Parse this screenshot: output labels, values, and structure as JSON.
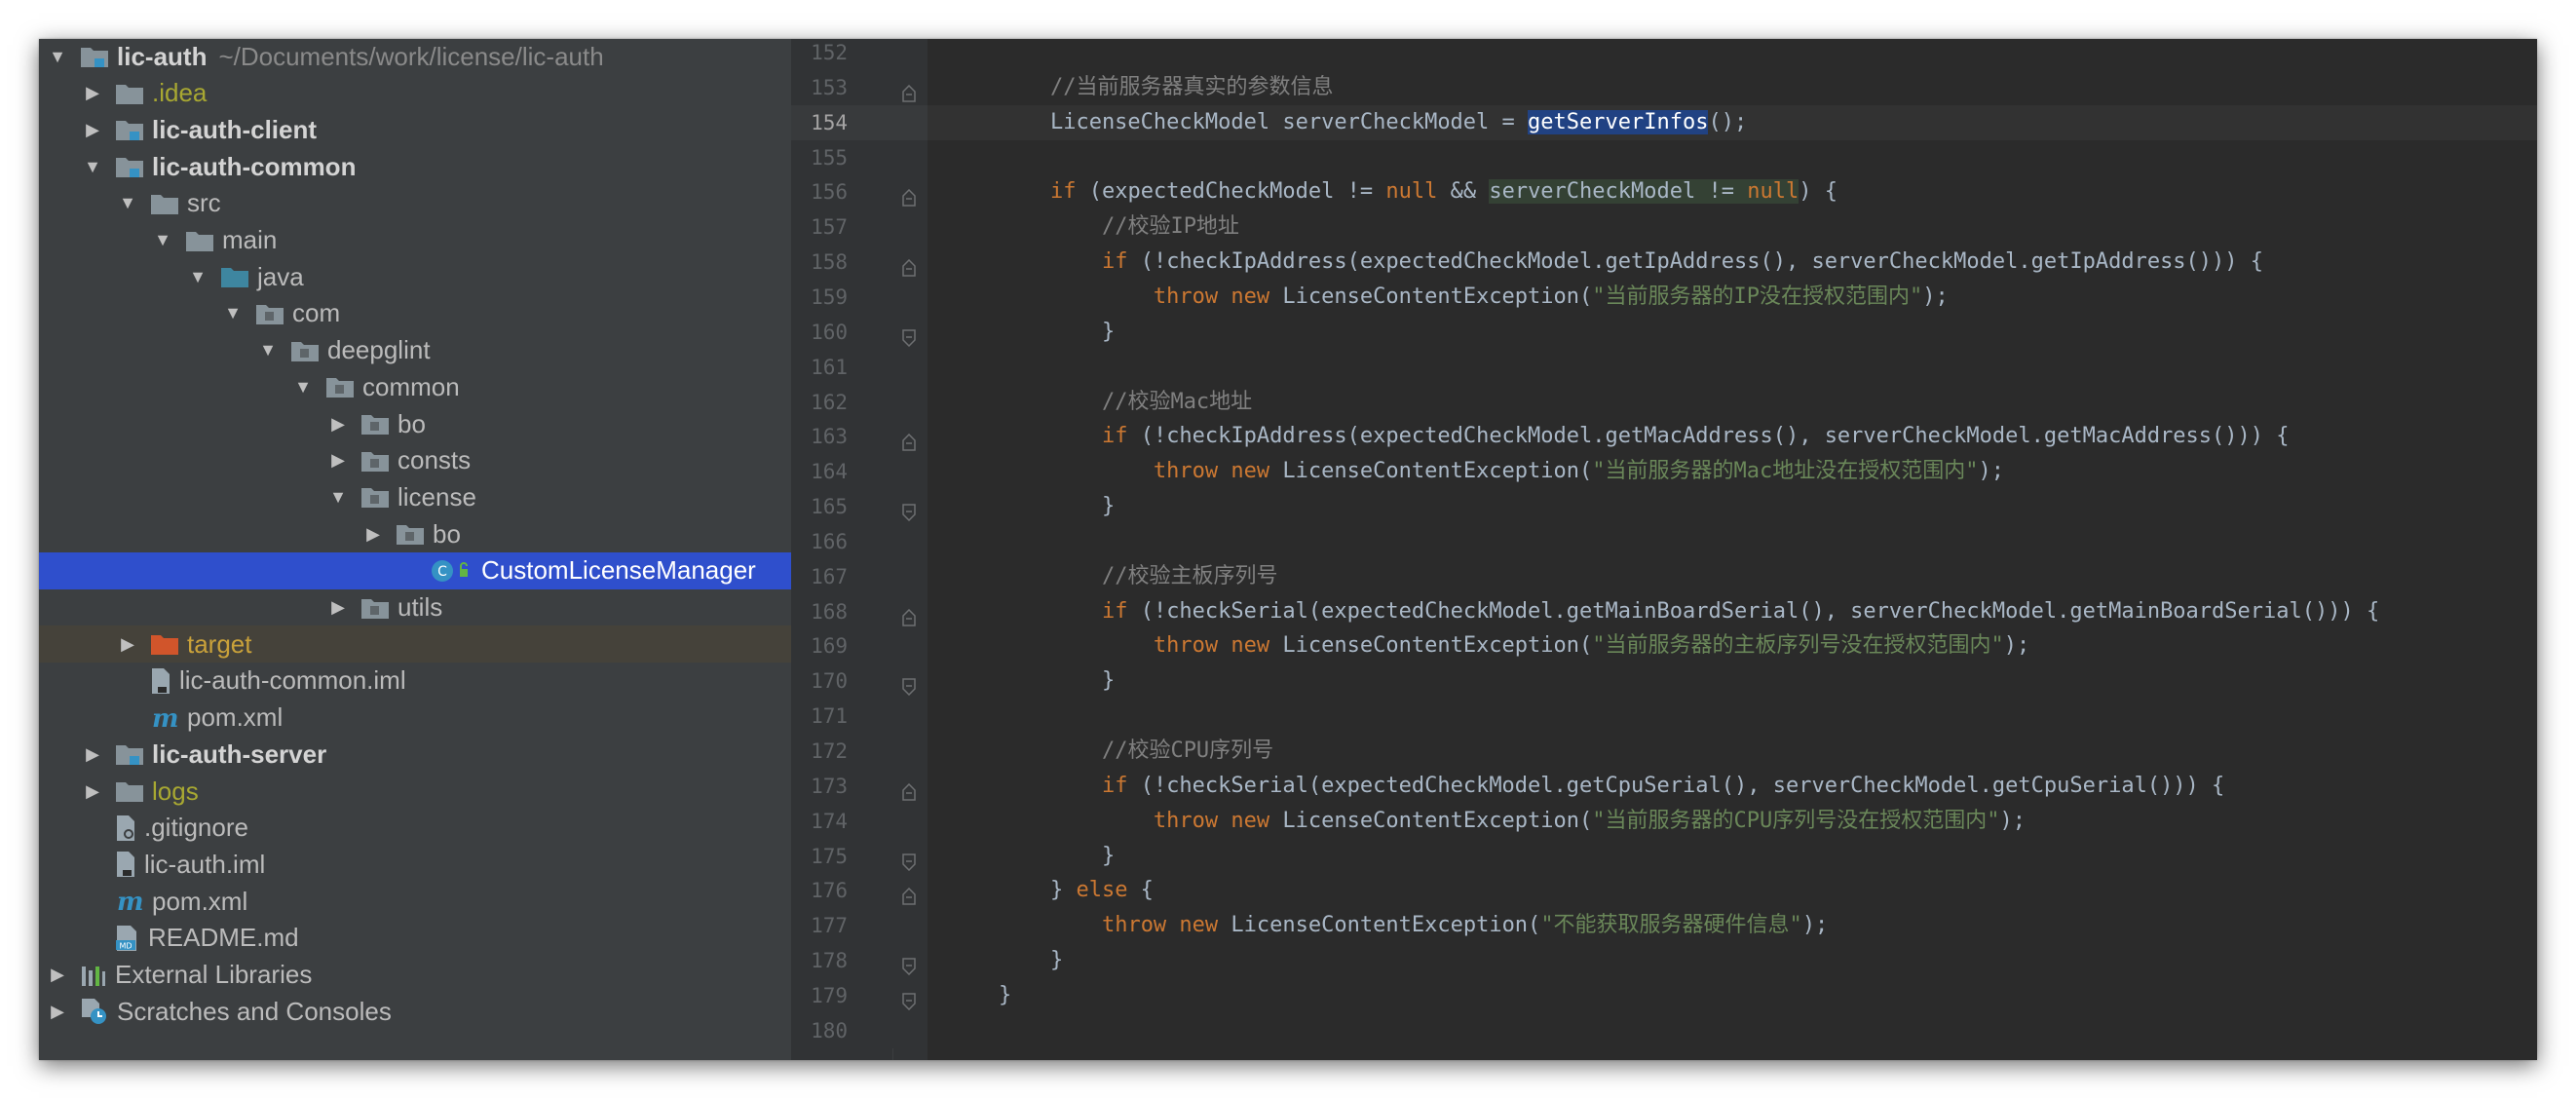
{
  "tree": {
    "rows": [
      {
        "label": "lic-auth",
        "path": "~/Documents/work/license/lic-auth",
        "depth": 0,
        "arrow": "down",
        "icon": "module-folder-icon",
        "style": "bold"
      },
      {
        "label": ".idea",
        "depth": 1,
        "arrow": "right",
        "icon": "folder-icon",
        "style": "yellow"
      },
      {
        "label": "lic-auth-client",
        "depth": 1,
        "arrow": "right",
        "icon": "module-folder-icon",
        "style": "bold"
      },
      {
        "label": "lic-auth-common",
        "depth": 1,
        "arrow": "down",
        "icon": "module-folder-icon",
        "style": "bold"
      },
      {
        "label": "src",
        "depth": 2,
        "arrow": "down",
        "icon": "folder-icon",
        "style": "normal"
      },
      {
        "label": "main",
        "depth": 3,
        "arrow": "down",
        "icon": "folder-icon",
        "style": "normal"
      },
      {
        "label": "java",
        "depth": 4,
        "arrow": "down",
        "icon": "source-folder-icon",
        "style": "normal"
      },
      {
        "label": "com",
        "depth": 5,
        "arrow": "down",
        "icon": "package-icon",
        "style": "normal"
      },
      {
        "label": "deepglint",
        "depth": 6,
        "arrow": "down",
        "icon": "package-icon",
        "style": "normal"
      },
      {
        "label": "common",
        "depth": 7,
        "arrow": "down",
        "icon": "package-icon",
        "style": "normal"
      },
      {
        "label": "bo",
        "depth": 8,
        "arrow": "right",
        "icon": "package-icon",
        "style": "normal"
      },
      {
        "label": "consts",
        "depth": 8,
        "arrow": "right",
        "icon": "package-icon",
        "style": "normal"
      },
      {
        "label": "license",
        "depth": 8,
        "arrow": "down",
        "icon": "package-icon",
        "style": "normal"
      },
      {
        "label": "bo",
        "depth": 9,
        "arrow": "right",
        "icon": "package-icon",
        "style": "normal"
      },
      {
        "label": "CustomLicenseManager",
        "depth": 10,
        "arrow": "none",
        "icon": "java-class-icon",
        "style": "selected"
      },
      {
        "label": "utils",
        "depth": 8,
        "arrow": "right",
        "icon": "package-icon",
        "style": "normal"
      },
      {
        "label": "target",
        "depth": 2,
        "arrow": "right",
        "icon": "excluded-folder-icon",
        "style": "excluded"
      },
      {
        "label": "lic-auth-common.iml",
        "depth": 2,
        "arrow": "none",
        "icon": "iml-file-icon",
        "style": "normal"
      },
      {
        "label": "pom.xml",
        "depth": 2,
        "arrow": "none",
        "icon": "maven-icon",
        "style": "normal"
      },
      {
        "label": "lic-auth-server",
        "depth": 1,
        "arrow": "right",
        "icon": "module-folder-icon",
        "style": "bold"
      },
      {
        "label": "logs",
        "depth": 1,
        "arrow": "right",
        "icon": "folder-icon",
        "style": "yellow"
      },
      {
        "label": ".gitignore",
        "depth": 1,
        "arrow": "none",
        "icon": "gitignore-file-icon",
        "style": "normal"
      },
      {
        "label": "lic-auth.iml",
        "depth": 1,
        "arrow": "none",
        "icon": "iml-file-icon",
        "style": "normal"
      },
      {
        "label": "pom.xml",
        "depth": 1,
        "arrow": "none",
        "icon": "maven-icon",
        "style": "normal"
      },
      {
        "label": "README.md",
        "depth": 1,
        "arrow": "none",
        "icon": "markdown-file-icon",
        "style": "normal"
      },
      {
        "label": "External Libraries",
        "depth": 0,
        "arrow": "right",
        "icon": "libraries-icon",
        "style": "normal"
      },
      {
        "label": "Scratches and Consoles",
        "depth": 0,
        "arrow": "right",
        "icon": "scratches-icon",
        "style": "normal"
      }
    ]
  },
  "editor": {
    "current_line": "154",
    "lines": [
      {
        "n": "152",
        "fold": "",
        "tokens": []
      },
      {
        "n": "153",
        "fold": "up",
        "tokens": [
          {
            "t": "        "
          },
          {
            "t": "//当前服务器真实的参数信息",
            "c": "cmt"
          }
        ]
      },
      {
        "n": "154",
        "fold": "",
        "tokens": [
          {
            "t": "        LicenseCheckModel serverCheckModel = "
          },
          {
            "t": "getServerInfos",
            "c": "hl-sel"
          },
          {
            "t": "();"
          }
        ]
      },
      {
        "n": "155",
        "fold": "",
        "tokens": []
      },
      {
        "n": "156",
        "fold": "up",
        "tokens": [
          {
            "t": "        "
          },
          {
            "t": "if",
            "c": "kw"
          },
          {
            "t": " (expectedCheckModel != "
          },
          {
            "t": "null",
            "c": "kw"
          },
          {
            "t": " && "
          },
          {
            "t": "serverCheckModel != ",
            "c": "hl-usage"
          },
          {
            "t": "null",
            "c": "kw hl-usage"
          },
          {
            "t": ") {"
          }
        ]
      },
      {
        "n": "157",
        "fold": "",
        "tokens": [
          {
            "t": "            "
          },
          {
            "t": "//校验IP地址",
            "c": "cmt"
          }
        ]
      },
      {
        "n": "158",
        "fold": "up",
        "tokens": [
          {
            "t": "            "
          },
          {
            "t": "if",
            "c": "kw"
          },
          {
            "t": " (!checkIpAddress(expectedCheckModel.getIpAddress(), serverCheckModel.getIpAddress())) {"
          }
        ]
      },
      {
        "n": "159",
        "fold": "",
        "tokens": [
          {
            "t": "                "
          },
          {
            "t": "throw new",
            "c": "kw"
          },
          {
            "t": " LicenseContentException("
          },
          {
            "t": "\"当前服务器的IP没在授权范围内\"",
            "c": "str"
          },
          {
            "t": ");"
          }
        ]
      },
      {
        "n": "160",
        "fold": "down",
        "tokens": [
          {
            "t": "            }"
          }
        ]
      },
      {
        "n": "161",
        "fold": "",
        "tokens": []
      },
      {
        "n": "162",
        "fold": "",
        "tokens": [
          {
            "t": "            "
          },
          {
            "t": "//校验Mac地址",
            "c": "cmt"
          }
        ]
      },
      {
        "n": "163",
        "fold": "up",
        "tokens": [
          {
            "t": "            "
          },
          {
            "t": "if",
            "c": "kw"
          },
          {
            "t": " (!checkIpAddress(expectedCheckModel.getMacAddress(), serverCheckModel.getMacAddress())) {"
          }
        ]
      },
      {
        "n": "164",
        "fold": "",
        "tokens": [
          {
            "t": "                "
          },
          {
            "t": "throw new",
            "c": "kw"
          },
          {
            "t": " LicenseContentException("
          },
          {
            "t": "\"当前服务器的Mac地址没在授权范围内\"",
            "c": "str"
          },
          {
            "t": ");"
          }
        ]
      },
      {
        "n": "165",
        "fold": "down",
        "tokens": [
          {
            "t": "            }"
          }
        ]
      },
      {
        "n": "166",
        "fold": "",
        "tokens": []
      },
      {
        "n": "167",
        "fold": "",
        "tokens": [
          {
            "t": "            "
          },
          {
            "t": "//校验主板序列号",
            "c": "cmt"
          }
        ]
      },
      {
        "n": "168",
        "fold": "up",
        "tokens": [
          {
            "t": "            "
          },
          {
            "t": "if",
            "c": "kw"
          },
          {
            "t": " (!checkSerial(expectedCheckModel.getMainBoardSerial(), serverCheckModel.getMainBoardSerial())) {"
          }
        ]
      },
      {
        "n": "169",
        "fold": "",
        "tokens": [
          {
            "t": "                "
          },
          {
            "t": "throw new",
            "c": "kw"
          },
          {
            "t": " LicenseContentException("
          },
          {
            "t": "\"当前服务器的主板序列号没在授权范围内\"",
            "c": "str"
          },
          {
            "t": ");"
          }
        ]
      },
      {
        "n": "170",
        "fold": "down",
        "tokens": [
          {
            "t": "            }"
          }
        ]
      },
      {
        "n": "171",
        "fold": "",
        "tokens": []
      },
      {
        "n": "172",
        "fold": "",
        "tokens": [
          {
            "t": "            "
          },
          {
            "t": "//校验CPU序列号",
            "c": "cmt"
          }
        ]
      },
      {
        "n": "173",
        "fold": "up",
        "tokens": [
          {
            "t": "            "
          },
          {
            "t": "if",
            "c": "kw"
          },
          {
            "t": " (!checkSerial(expectedCheckModel.getCpuSerial(), serverCheckModel.getCpuSerial())) {"
          }
        ]
      },
      {
        "n": "174",
        "fold": "",
        "tokens": [
          {
            "t": "                "
          },
          {
            "t": "throw new",
            "c": "kw"
          },
          {
            "t": " LicenseContentException("
          },
          {
            "t": "\"当前服务器的CPU序列号没在授权范围内\"",
            "c": "str"
          },
          {
            "t": ");"
          }
        ]
      },
      {
        "n": "175",
        "fold": "down",
        "tokens": [
          {
            "t": "            }"
          }
        ]
      },
      {
        "n": "176",
        "fold": "up",
        "tokens": [
          {
            "t": "        } "
          },
          {
            "t": "else",
            "c": "kw"
          },
          {
            "t": " {"
          }
        ]
      },
      {
        "n": "177",
        "fold": "",
        "tokens": [
          {
            "t": "            "
          },
          {
            "t": "throw new",
            "c": "kw"
          },
          {
            "t": " LicenseContentException("
          },
          {
            "t": "\"不能获取服务器硬件信息\"",
            "c": "str"
          },
          {
            "t": ");"
          }
        ]
      },
      {
        "n": "178",
        "fold": "down",
        "tokens": [
          {
            "t": "        }"
          }
        ]
      },
      {
        "n": "179",
        "fold": "down",
        "tokens": [
          {
            "t": "    }"
          }
        ]
      },
      {
        "n": "180",
        "fold": "",
        "tokens": []
      }
    ]
  },
  "colors": {
    "tree_bg": "#3c3f41",
    "editor_bg": "#2b2b2b",
    "selection": "#2f4fcc",
    "keyword": "#cc7832",
    "string": "#6a8759",
    "comment": "#808080"
  }
}
